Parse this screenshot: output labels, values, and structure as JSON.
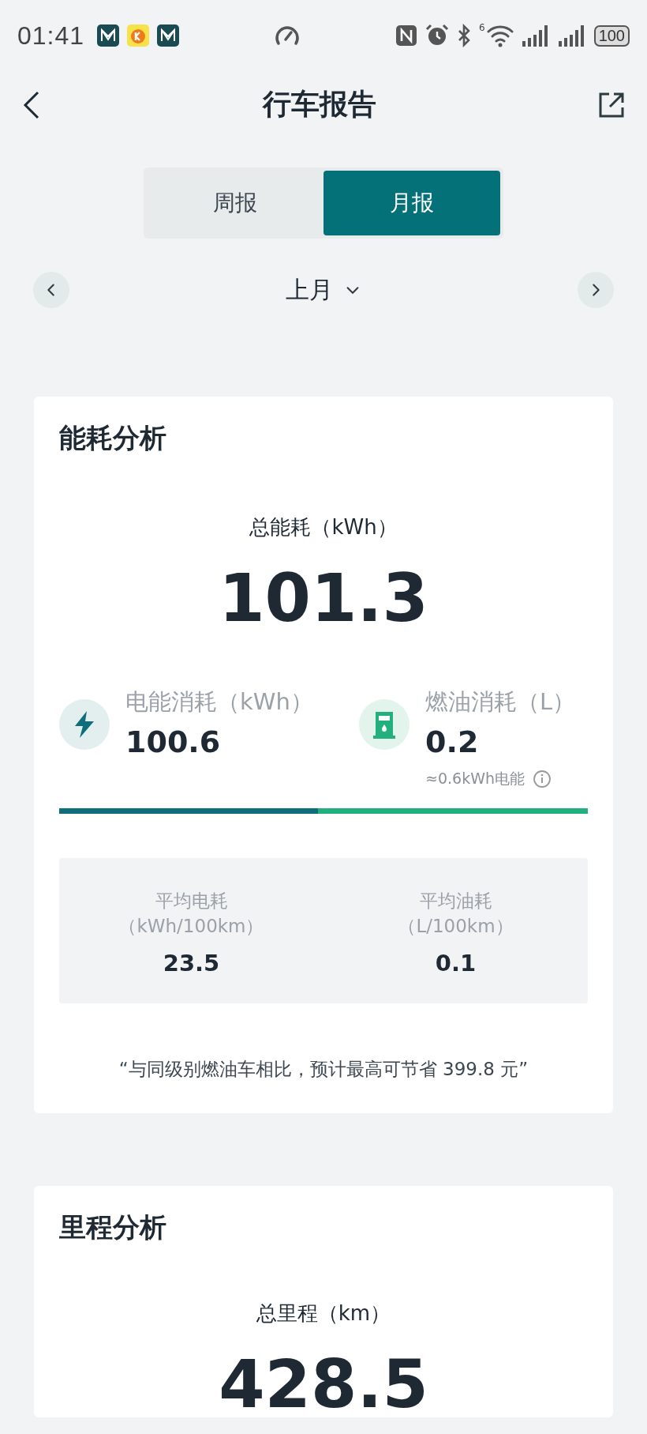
{
  "status_bar": {
    "time": "01:41",
    "wifi_badge": "6",
    "battery": "100"
  },
  "header": {
    "title": "行车报告"
  },
  "tabs": [
    {
      "label": "周报",
      "selected": false
    },
    {
      "label": "月报",
      "selected": true
    }
  ],
  "period": {
    "label": "上月"
  },
  "energy_card": {
    "title": "能耗分析",
    "total_label": "总能耗（kWh）",
    "total_value": "101.3",
    "sources": [
      {
        "kind": "electric",
        "label": "电能消耗（kWh）",
        "value": "100.6"
      },
      {
        "kind": "fuel",
        "label": "燃油消耗（L）",
        "value": "0.2",
        "note": "≈0.6kWh电能"
      }
    ],
    "share_bar": {
      "level": 0.49
    },
    "averages": [
      {
        "label": "平均电耗",
        "unit": "（kWh/100km）",
        "value": "23.5"
      },
      {
        "label": "平均油耗",
        "unit": "（L/100km）",
        "value": "0.1"
      }
    ],
    "savings_note": "“与同级别燃油车相比，预计最高可节省 399.8 元”"
  },
  "mileage_card": {
    "title": "里程分析",
    "total_label": "总里程（km）",
    "total_value": "428.5"
  }
}
